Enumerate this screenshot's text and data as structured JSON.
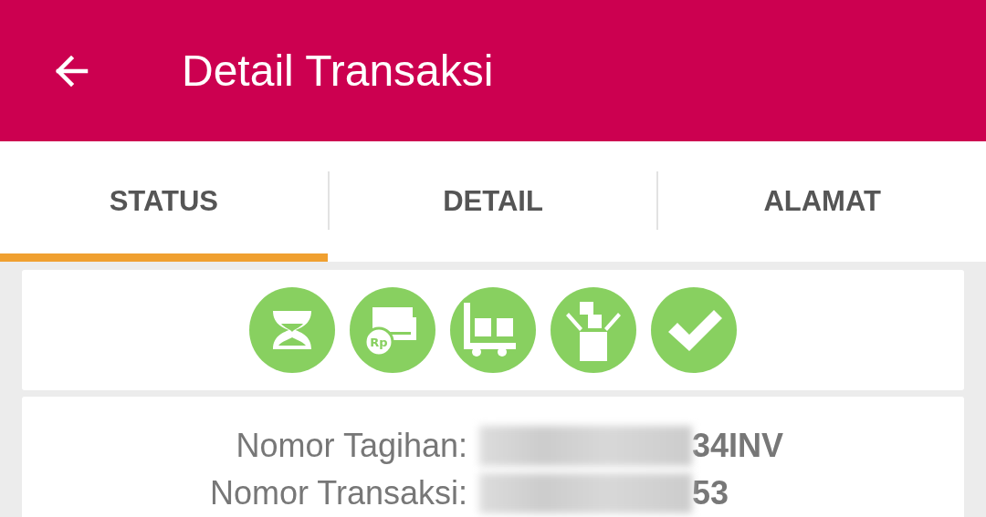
{
  "app_bar": {
    "title": "Detail Transaksi"
  },
  "tabs": [
    {
      "label": "STATUS",
      "selected": true
    },
    {
      "label": "DETAIL",
      "selected": false
    },
    {
      "label": "ALAMAT",
      "selected": false
    }
  ],
  "status_steps": [
    {
      "kind": "hourglass"
    },
    {
      "kind": "payment",
      "symbol": "Rp"
    },
    {
      "kind": "cart"
    },
    {
      "kind": "box"
    },
    {
      "kind": "check"
    }
  ],
  "fields": [
    {
      "label": "Nomor Tagihan:",
      "value": "34INV",
      "redacted": true
    },
    {
      "label": "Nomor Transaksi:",
      "value": "53",
      "redacted": true
    }
  ]
}
